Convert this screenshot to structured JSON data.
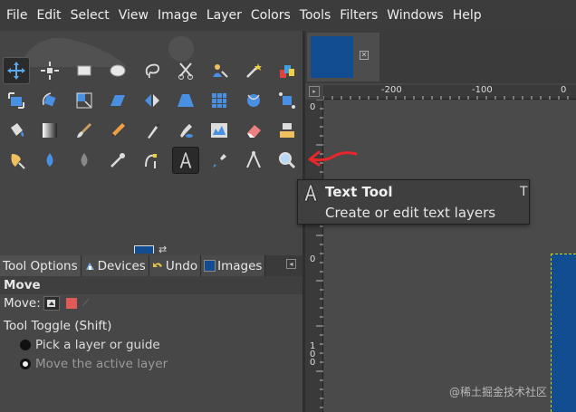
{
  "menubar": {
    "items": [
      "File",
      "Edit",
      "Select",
      "View",
      "Image",
      "Layer",
      "Colors",
      "Tools",
      "Filters",
      "Windows",
      "Help"
    ]
  },
  "toolbox": {
    "tools": [
      {
        "name": "move-tool",
        "icon": "move-icon"
      },
      {
        "name": "alignment-tool",
        "icon": "align-icon"
      },
      {
        "name": "rectangle-select-tool",
        "icon": "rect-select-icon"
      },
      {
        "name": "ellipse-select-tool",
        "icon": "ellipse-select-icon"
      },
      {
        "name": "free-select-tool",
        "icon": "lasso-icon"
      },
      {
        "name": "scissors-select-tool",
        "icon": "scissors-icon"
      },
      {
        "name": "foreground-select-tool",
        "icon": "foreground-select-icon"
      },
      {
        "name": "fuzzy-select-tool",
        "icon": "magic-wand-icon"
      },
      {
        "name": "select-by-color-tool",
        "icon": "color-select-icon"
      },
      {
        "name": "crop-tool",
        "icon": "crop-icon"
      },
      {
        "name": "unified-transform-tool",
        "icon": "unified-transform-icon"
      },
      {
        "name": "rotate-tool",
        "icon": "rotate-icon"
      },
      {
        "name": "scale-tool",
        "icon": "scale-icon"
      },
      {
        "name": "shear-tool",
        "icon": "shear-icon"
      },
      {
        "name": "flip-tool",
        "icon": "flip-icon"
      },
      {
        "name": "perspective-tool",
        "icon": "perspective-icon"
      },
      {
        "name": "3d-transform-tool",
        "icon": "grid-transform-icon"
      },
      {
        "name": "warp-transform-tool",
        "icon": "warp-icon"
      },
      {
        "name": "handle-transform-tool",
        "icon": "handle-transform-icon"
      },
      {
        "name": "cage-transform-tool",
        "icon": "cage-icon"
      },
      {
        "name": "bucket-fill-tool",
        "icon": "bucket-icon"
      },
      {
        "name": "gradient-tool",
        "icon": "gradient-icon"
      },
      {
        "name": "paintbrush-tool",
        "icon": "paintbrush-icon"
      },
      {
        "name": "pencil-tool",
        "icon": "pencil-icon"
      },
      {
        "name": "ink-tool",
        "icon": "ink-icon"
      },
      {
        "name": "mypaint-brush-tool",
        "icon": "mypaint-icon"
      },
      {
        "name": "histogram-tool",
        "icon": "histogram-icon"
      },
      {
        "name": "eraser-tool",
        "icon": "eraser-icon"
      },
      {
        "name": "clone-tool",
        "icon": "clone-icon"
      },
      {
        "name": "heal-tool",
        "icon": "heal-icon"
      },
      {
        "name": "smudge-tool",
        "icon": "smudge-icon"
      },
      {
        "name": "dodge-burn-tool",
        "icon": "dodge-icon"
      },
      {
        "name": "blur-tool",
        "icon": "blur-icon"
      },
      {
        "name": "airbrush-tool",
        "icon": "airbrush-icon"
      },
      {
        "name": "paths-tool",
        "icon": "paths-icon"
      },
      {
        "name": "text-tool",
        "icon": "text-icon"
      },
      {
        "name": "color-picker-tool",
        "icon": "color-picker-icon"
      },
      {
        "name": "measure-tool",
        "icon": "measure-icon"
      },
      {
        "name": "zoom-tool",
        "icon": "zoom-icon"
      }
    ],
    "fg_color": "#124c91",
    "bg_color": "#d6b48c"
  },
  "dock_tabs": [
    "Tool Options",
    "Devices",
    "Undo",
    "Images"
  ],
  "tool_options": {
    "title": "Move",
    "move_label": "Move:",
    "toggle_label": "Tool Toggle  (Shift)",
    "radio_pick": "Pick a layer or guide",
    "radio_move": "Move the active layer"
  },
  "rulers": {
    "h_labels": [
      "-200",
      "-100",
      "0"
    ],
    "v_labels": [
      "0",
      "0",
      "1 0 0"
    ]
  },
  "tooltip": {
    "title": "Text Tool",
    "shortcut": "T",
    "description": "Create or edit text layers"
  },
  "image_color": "#124c91",
  "watermark": "@稀土掘金技术社区"
}
